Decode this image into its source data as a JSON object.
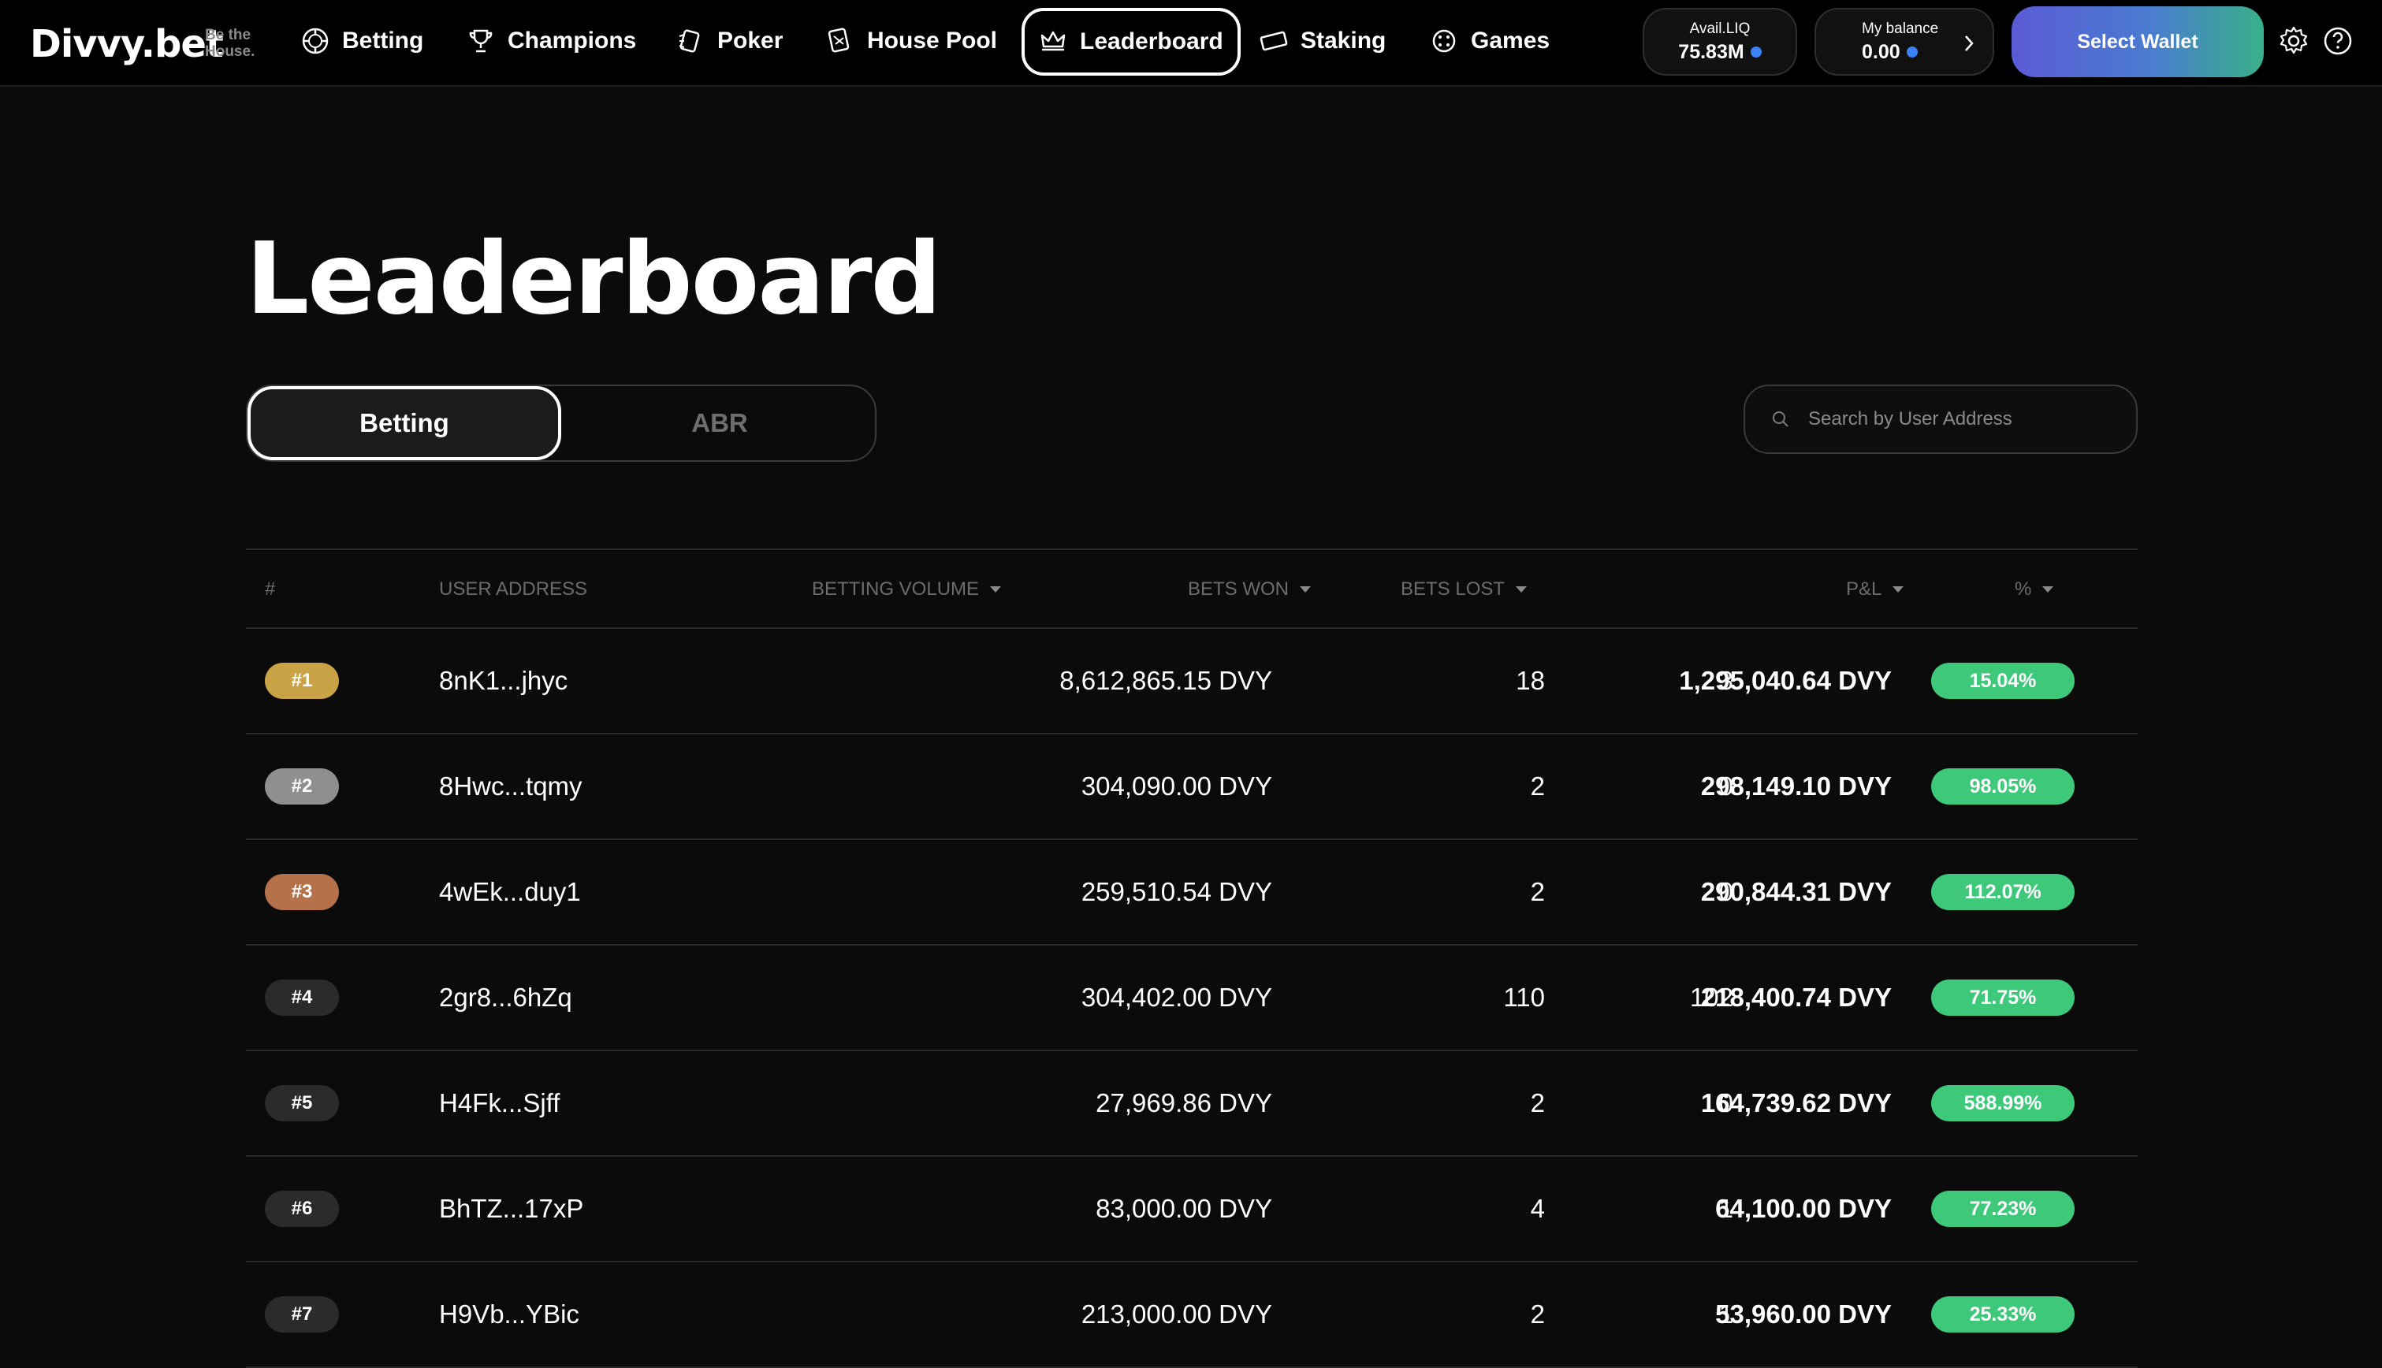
{
  "brand": {
    "logo": "Divvy.bet",
    "tagline": "Be the House."
  },
  "nav": {
    "items": [
      {
        "label": "Betting",
        "icon": "betting-chip-icon"
      },
      {
        "label": "Champions",
        "icon": "trophy-icon"
      },
      {
        "label": "Poker",
        "icon": "poker-cards-icon"
      },
      {
        "label": "House Pool",
        "icon": "house-pool-icon"
      },
      {
        "label": "Leaderboard",
        "icon": "crown-icon",
        "active": true
      },
      {
        "label": "Staking",
        "icon": "staking-ticket-icon"
      },
      {
        "label": "Games",
        "icon": "games-dice-icon"
      }
    ],
    "avail_liq": {
      "label": "Avail.LIQ",
      "value": "75.83M"
    },
    "balance": {
      "label": "My balance",
      "value": "0.00"
    },
    "select_wallet": "Select Wallet",
    "settings_icon": "gear-icon",
    "help_icon": "help-icon"
  },
  "page": {
    "title": "Leaderboard",
    "tabs": [
      {
        "label": "Betting",
        "active": true
      },
      {
        "label": "ABR",
        "active": false
      }
    ],
    "search": {
      "placeholder": "Search by User Address",
      "value": ""
    }
  },
  "table": {
    "columns": {
      "rank": "#",
      "address": "USER ADDRESS",
      "volume": "BETTING VOLUME",
      "won": "BETS WON",
      "lost": "BETS LOST",
      "pnl": "P&L",
      "pct": "%"
    },
    "rows": [
      {
        "rank": "#1",
        "address": "8nK1...jhyc",
        "volume": "8,612,865.15 DVY",
        "won": "18",
        "lost": "3",
        "pnl": "1,295,040.64 DVY",
        "pct": "15.04%"
      },
      {
        "rank": "#2",
        "address": "8Hwc...tqmy",
        "volume": "304,090.00 DVY",
        "won": "2",
        "lost": "0",
        "pnl": "298,149.10 DVY",
        "pct": "98.05%"
      },
      {
        "rank": "#3",
        "address": "4wEk...duy1",
        "volume": "259,510.54 DVY",
        "won": "2",
        "lost": "0",
        "pnl": "290,844.31 DVY",
        "pct": "112.07%"
      },
      {
        "rank": "#4",
        "address": "2gr8...6hZq",
        "volume": "304,402.00 DVY",
        "won": "110",
        "lost": "102",
        "pnl": "218,400.74 DVY",
        "pct": "71.75%"
      },
      {
        "rank": "#5",
        "address": "H4Fk...Sjff",
        "volume": "27,969.86 DVY",
        "won": "2",
        "lost": "0",
        "pnl": "164,739.62 DVY",
        "pct": "588.99%"
      },
      {
        "rank": "#6",
        "address": "BhTZ...17xP",
        "volume": "83,000.00 DVY",
        "won": "4",
        "lost": "1",
        "pnl": "64,100.00 DVY",
        "pct": "77.23%"
      },
      {
        "rank": "#7",
        "address": "H9Vb...YBic",
        "volume": "213,000.00 DVY",
        "won": "2",
        "lost": "1",
        "pnl": "53,960.00 DVY",
        "pct": "25.33%"
      }
    ]
  },
  "colors": {
    "background": "#0b0b0b",
    "gold": "#c9a345",
    "silver": "#8f8f8f",
    "bronze": "#b5724a",
    "positive": "#3ec97a"
  }
}
